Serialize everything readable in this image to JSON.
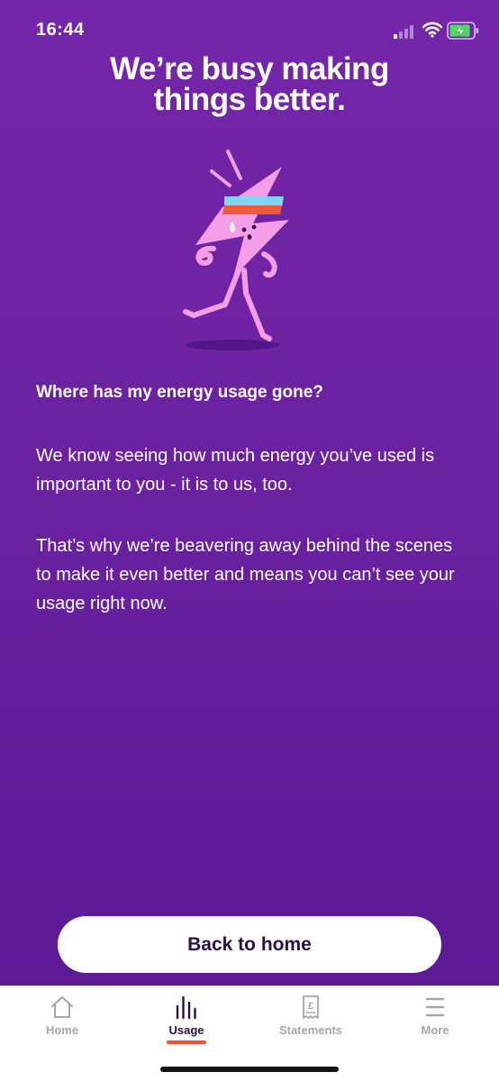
{
  "status_bar": {
    "time": "16:44"
  },
  "headline": {
    "line1": "We’re busy making",
    "line2": "things better."
  },
  "content": {
    "question": "Where has my energy usage gone?",
    "paragraph1": "We know seeing how much energy you’ve used is important to you - it is to us, too.",
    "paragraph2": "That’s why we’re beavering away behind the scenes to make it even better and means you can’t see your usage right now."
  },
  "actions": {
    "back_home_label": "Back to home"
  },
  "tabs": [
    {
      "label": "Home",
      "icon": "house-icon",
      "active": false
    },
    {
      "label": "Usage",
      "icon": "bar-chart-icon",
      "active": true
    },
    {
      "label": "Statements",
      "icon": "pound-receipt-icon",
      "active": false
    },
    {
      "label": "More",
      "icon": "hamburger-menu-icon",
      "active": false
    }
  ],
  "colors": {
    "background": "#6a22a0",
    "button_text": "#2a1046",
    "tab_active_underline": "#f0503c",
    "mascot": "#f59ee8"
  }
}
